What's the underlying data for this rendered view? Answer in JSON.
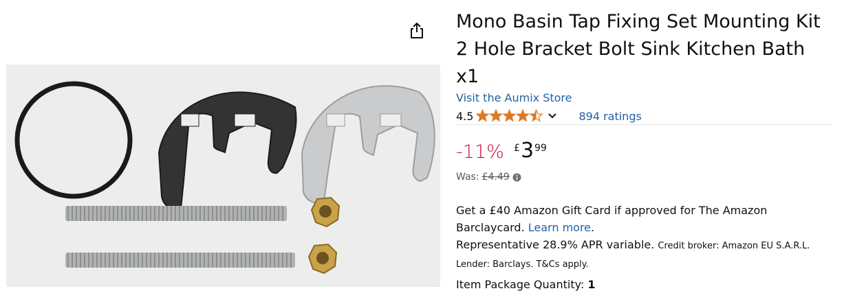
{
  "share": {
    "icon": "share-icon"
  },
  "product": {
    "title": "Mono Basin Tap Fixing Set Mounting Kit 2 Hole Bracket Bolt Sink Kitchen Bath x1",
    "image_alt": "Mono basin tap fixing kit: rubber O-ring, black rubber bracket, metal bracket, two threaded bolts and two brass nuts"
  },
  "store": {
    "link_text": "Visit the Aumix Store"
  },
  "rating": {
    "value": "4.5",
    "stars_fraction": 0.9,
    "star_color": "#de7921",
    "count_text": "894 ratings"
  },
  "price": {
    "discount": "-11%",
    "currency": "£",
    "whole": "3",
    "fraction": "99",
    "was_label": "Was:",
    "was_price": "£4.49",
    "discount_color": "#cc0c39"
  },
  "promo": {
    "line1": "Get a £40 Amazon Gift Card if approved for The Amazon Barclaycard.",
    "learn_more": "Learn more",
    "period": ".",
    "apr_text": "Representative 28.9% APR variable.",
    "broker_text": "Credit broker: Amazon EU S.A.R.L. Lender: Barclays. T&Cs apply."
  },
  "quantity": {
    "label": "Item Package Quantity:",
    "value": "1"
  },
  "colors": {
    "link": "#2162a1",
    "text": "#0f1111",
    "muted": "#565959"
  }
}
